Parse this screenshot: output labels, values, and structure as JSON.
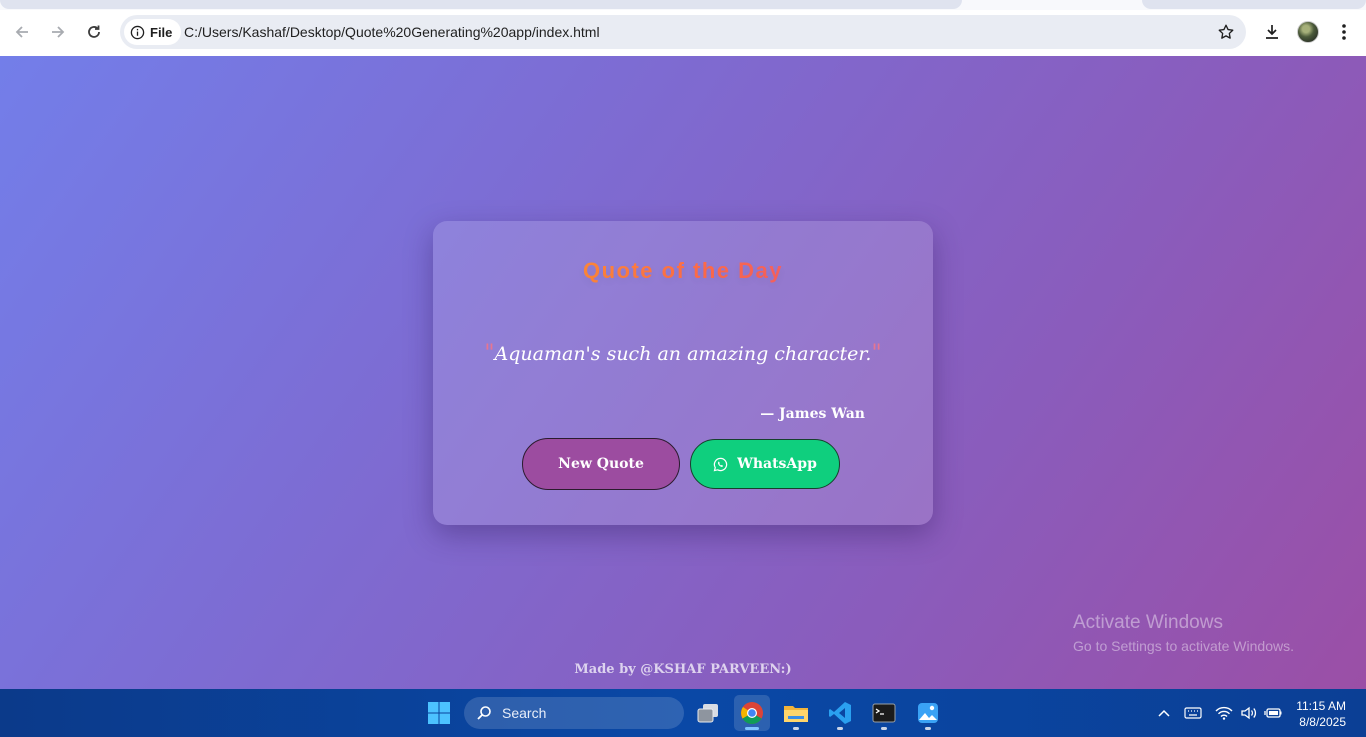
{
  "browser": {
    "site_label": "File",
    "url": "C:/Users/Kashaf/Desktop/Quote%20Generating%20app/index.html"
  },
  "card": {
    "title": "Quote of the Day",
    "open_quote_mark": "\"",
    "quote_text": "Aquaman's such an amazing character.",
    "close_quote_mark": "\"",
    "author": "— James Wan",
    "new_quote_label": "New Quote",
    "whatsapp_label": "WhatsApp"
  },
  "footer": {
    "credit": "Made by @KSHAF PARVEEN:)"
  },
  "watermark": {
    "title": "Activate Windows",
    "subtitle": "Go to Settings to activate Windows."
  },
  "taskbar": {
    "search_placeholder": "Search",
    "time": "11:15 AM",
    "date": "8/8/2025"
  },
  "colors": {
    "background_start": "#737ee9",
    "background_end": "#9b4fa6",
    "new_quote_button": "#9c4ca0",
    "whatsapp_button": "#0fcf7e",
    "title_gradient_start": "#ffaa22",
    "title_gradient_end": "#e6508a",
    "quote_mark": "#e8758f"
  },
  "icons": [
    "back-arrow-icon",
    "forward-arrow-icon",
    "reload-icon",
    "info-icon",
    "star-icon",
    "download-icon",
    "kebab-menu-icon",
    "whatsapp-icon",
    "windows-start-icon",
    "search-icon",
    "chrome-icon",
    "file-explorer-icon",
    "vscode-icon",
    "terminal-icon",
    "photos-icon",
    "chevron-up-icon",
    "keyboard-icon",
    "wifi-icon",
    "volume-icon",
    "battery-icon"
  ]
}
